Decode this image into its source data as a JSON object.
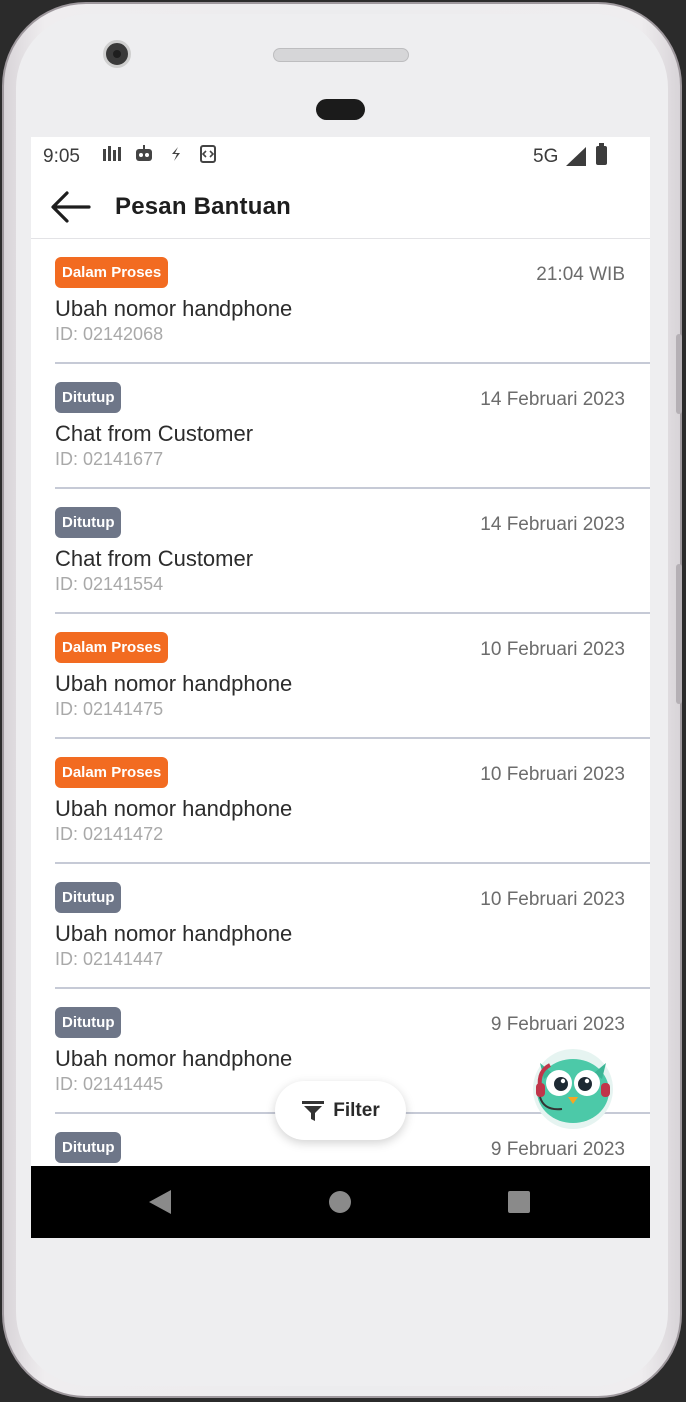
{
  "status_bar": {
    "time": "9:05",
    "network": "5G",
    "left_icons": [
      "signal-bars-icon",
      "robot-icon",
      "sync-icon",
      "code-icon"
    ]
  },
  "app_bar": {
    "title": "Pesan Bantuan",
    "back_icon": "arrow-left-icon"
  },
  "tickets": [
    {
      "status": "Dalam Proses",
      "status_color": "#f26b21",
      "date": "21:04 WIB",
      "subject": "Ubah nomor handphone",
      "id": "ID: 02142068"
    },
    {
      "status": "Ditutup",
      "status_color": "#6e7688",
      "date": "14 Februari 2023",
      "subject": "Chat from Customer",
      "id": "ID: 02141677"
    },
    {
      "status": "Ditutup",
      "status_color": "#6e7688",
      "date": "14 Februari 2023",
      "subject": "Chat from Customer",
      "id": "ID: 02141554"
    },
    {
      "status": "Dalam Proses",
      "status_color": "#f26b21",
      "date": "10 Februari 2023",
      "subject": "Ubah nomor handphone",
      "id": "ID: 02141475"
    },
    {
      "status": "Dalam Proses",
      "status_color": "#f26b21",
      "date": "10 Februari 2023",
      "subject": "Ubah nomor handphone",
      "id": "ID: 02141472"
    },
    {
      "status": "Ditutup",
      "status_color": "#6e7688",
      "date": "10 Februari 2023",
      "subject": "Ubah nomor handphone",
      "id": "ID: 02141447"
    },
    {
      "status": "Ditutup",
      "status_color": "#6e7688",
      "date": "9 Februari 2023",
      "subject": "Ubah nomor handphone",
      "id": "ID: 02141445"
    },
    {
      "status": "Ditutup",
      "status_color": "#6e7688",
      "date": "9 Februari 2023",
      "subject": "",
      "id": ""
    }
  ],
  "filter_button": {
    "label": "Filter",
    "icon": "filter-icon"
  },
  "mascot": {
    "icon": "owl-mascot-icon"
  },
  "nav_bar": {
    "icons": [
      "nav-back-icon",
      "nav-home-icon",
      "nav-recents-icon"
    ]
  },
  "colors": {
    "proses": "#f26b21",
    "ditutup": "#6e7688",
    "divider": "#c6cad6"
  }
}
